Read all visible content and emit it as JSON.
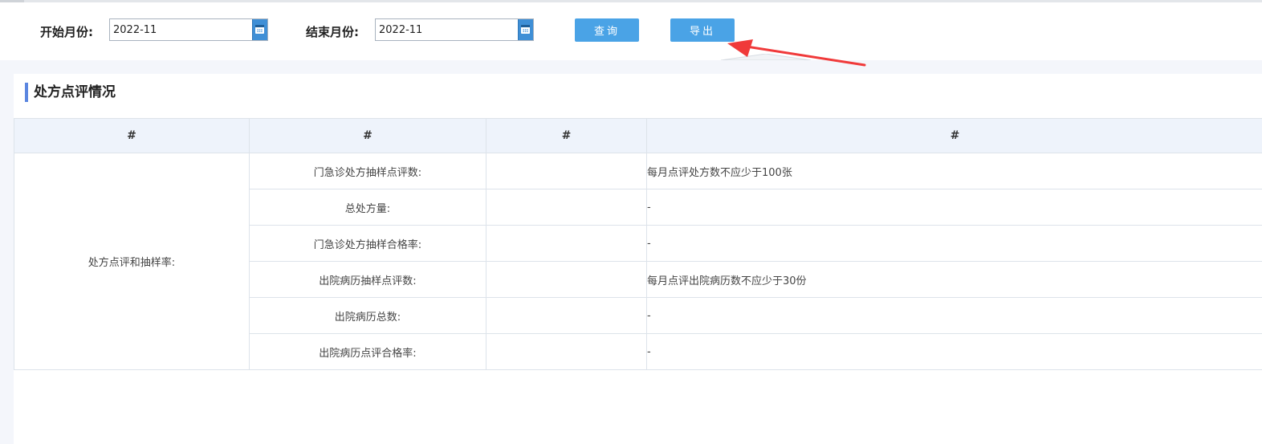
{
  "toolbar": {
    "start_label": "开始月份:",
    "start_value": "2022-11",
    "end_label": "结束月份:",
    "end_value": "2022-11",
    "query_label": "查询",
    "export_label": "导出"
  },
  "annotation": {
    "arrow_color": "#f03a3a"
  },
  "section": {
    "title": "处方点评情况"
  },
  "table": {
    "headers": [
      "#",
      "#",
      "#",
      "#"
    ],
    "group_label": "处方点评和抽样率:",
    "rows": [
      {
        "item": "门急诊处方抽样点评数:",
        "value": "",
        "note": "每月点评处方数不应少于100张"
      },
      {
        "item": "总处方量:",
        "value": "",
        "note": "-"
      },
      {
        "item": "门急诊处方抽样合格率:",
        "value": "",
        "note": "-"
      },
      {
        "item": "出院病历抽样点评数:",
        "value": "",
        "note": "每月点评出院病历数不应少于30份"
      },
      {
        "item": "出院病历总数:",
        "value": "",
        "note": "-"
      },
      {
        "item": "出院病历点评合格率:",
        "value": "",
        "note": "-"
      }
    ]
  },
  "colors": {
    "button": "#4aa3e6",
    "header_bg": "#eef3fb",
    "accent_bar": "#5b86e0"
  }
}
